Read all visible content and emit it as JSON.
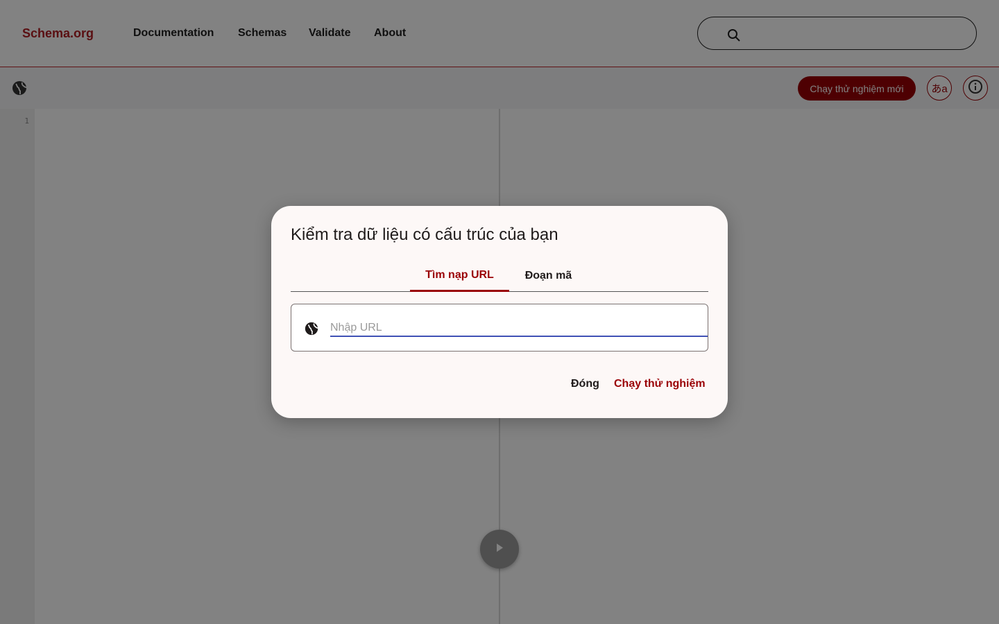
{
  "header": {
    "logo": "Schema.org",
    "nav": [
      "Documentation",
      "Schemas",
      "Validate",
      "About"
    ],
    "search": {
      "value": "",
      "placeholder": ""
    }
  },
  "toolbar": {
    "new_test_label": "Chạy thử nghiệm mới",
    "language_label": "あa"
  },
  "editor": {
    "line_numbers": [
      "1"
    ]
  },
  "dialog": {
    "title": "Kiểm tra dữ liệu có cấu trúc của bạn",
    "tabs": [
      "Tìm nạp URL",
      "Đoạn mã"
    ],
    "active_tab": "Tìm nạp URL",
    "url_input": {
      "value": "",
      "placeholder": "Nhập URL"
    },
    "close_label": "Đóng",
    "run_label": "Chạy thử nghiệm"
  },
  "colors": {
    "brand": "#9a0005",
    "link_accent": "#b01f24",
    "input_focus": "#3f51b5"
  },
  "icons": [
    "search-icon",
    "globe-icon",
    "info-icon",
    "play-icon",
    "language-icon"
  ]
}
